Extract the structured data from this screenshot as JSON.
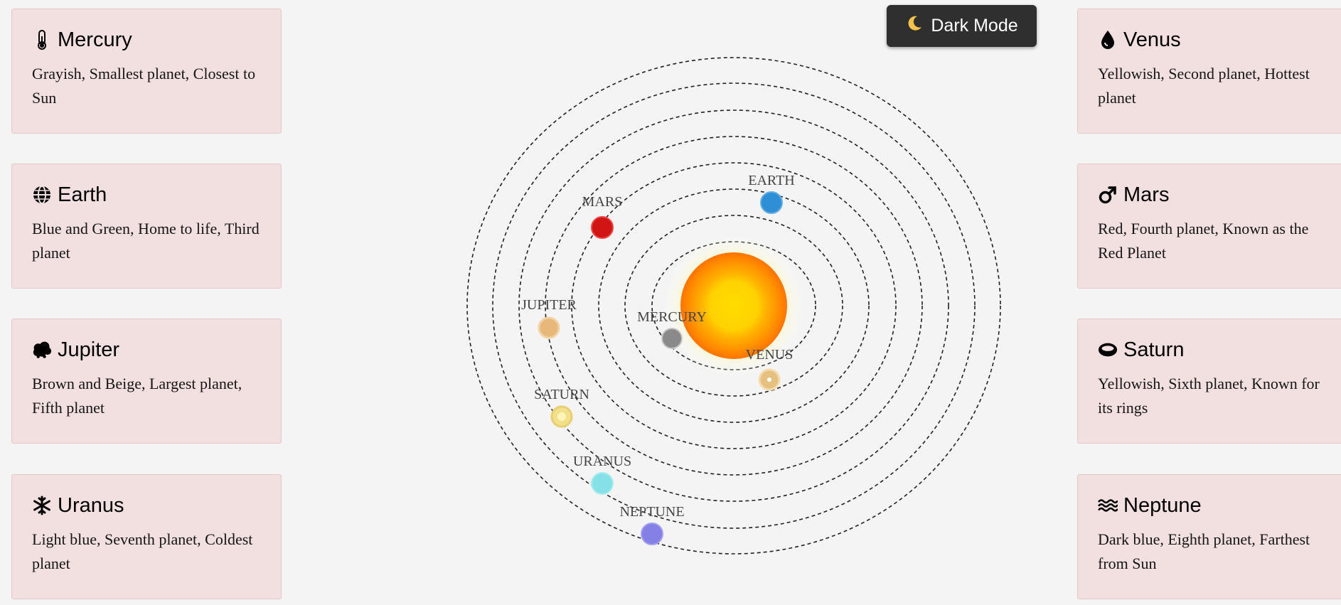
{
  "toolbar": {
    "dark_mode_label": "Dark Mode",
    "dark_mode_icon": "moon-icon"
  },
  "planets": {
    "mercury": {
      "title": "Mercury",
      "icon": "thermometer-icon",
      "desc": "Grayish, Smallest planet, Closest to Sun",
      "orbit_label": "MERCURY",
      "color": "#8a8a8a"
    },
    "venus": {
      "title": "Venus",
      "icon": "droplet-icon",
      "desc": "Yellowish, Second planet, Hottest planet",
      "orbit_label": "VENUS",
      "color": "#e9c48a"
    },
    "earth": {
      "title": "Earth",
      "icon": "globe-icon",
      "desc": "Blue and Green, Home to life, Third planet",
      "orbit_label": "EARTH",
      "color": "#2f8fd6"
    },
    "mars": {
      "title": "Mars",
      "icon": "mars-symbol-icon",
      "desc": "Red, Fourth planet, Known as the Red Planet",
      "orbit_label": "MARS",
      "color": "#d11414"
    },
    "jupiter": {
      "title": "Jupiter",
      "icon": "cloud-icon",
      "desc": "Brown and Beige, Largest planet, Fifth planet",
      "orbit_label": "JUPITER",
      "color": "#e8b87a"
    },
    "saturn": {
      "title": "Saturn",
      "icon": "ring-icon",
      "desc": "Yellowish, Sixth planet, Known for its rings",
      "orbit_label": "SATURN",
      "color": "#f3e08a"
    },
    "uranus": {
      "title": "Uranus",
      "icon": "snowflake-icon",
      "desc": "Light blue, Seventh planet, Coldest planet",
      "orbit_label": "URANUS",
      "color": "#86e0e8"
    },
    "neptune": {
      "title": "Neptune",
      "icon": "water-waves-icon",
      "desc": "Dark blue, Eighth planet, Farthest from Sun",
      "orbit_label": "NEPTUNE",
      "color": "#8480e6"
    }
  },
  "colors": {
    "card_bg": "#f2dfe0",
    "page_bg": "#f4f4f4",
    "button_bg": "#2f2f2f",
    "sun_core": "#ffd60a",
    "sun_outer": "#ff7a00"
  }
}
